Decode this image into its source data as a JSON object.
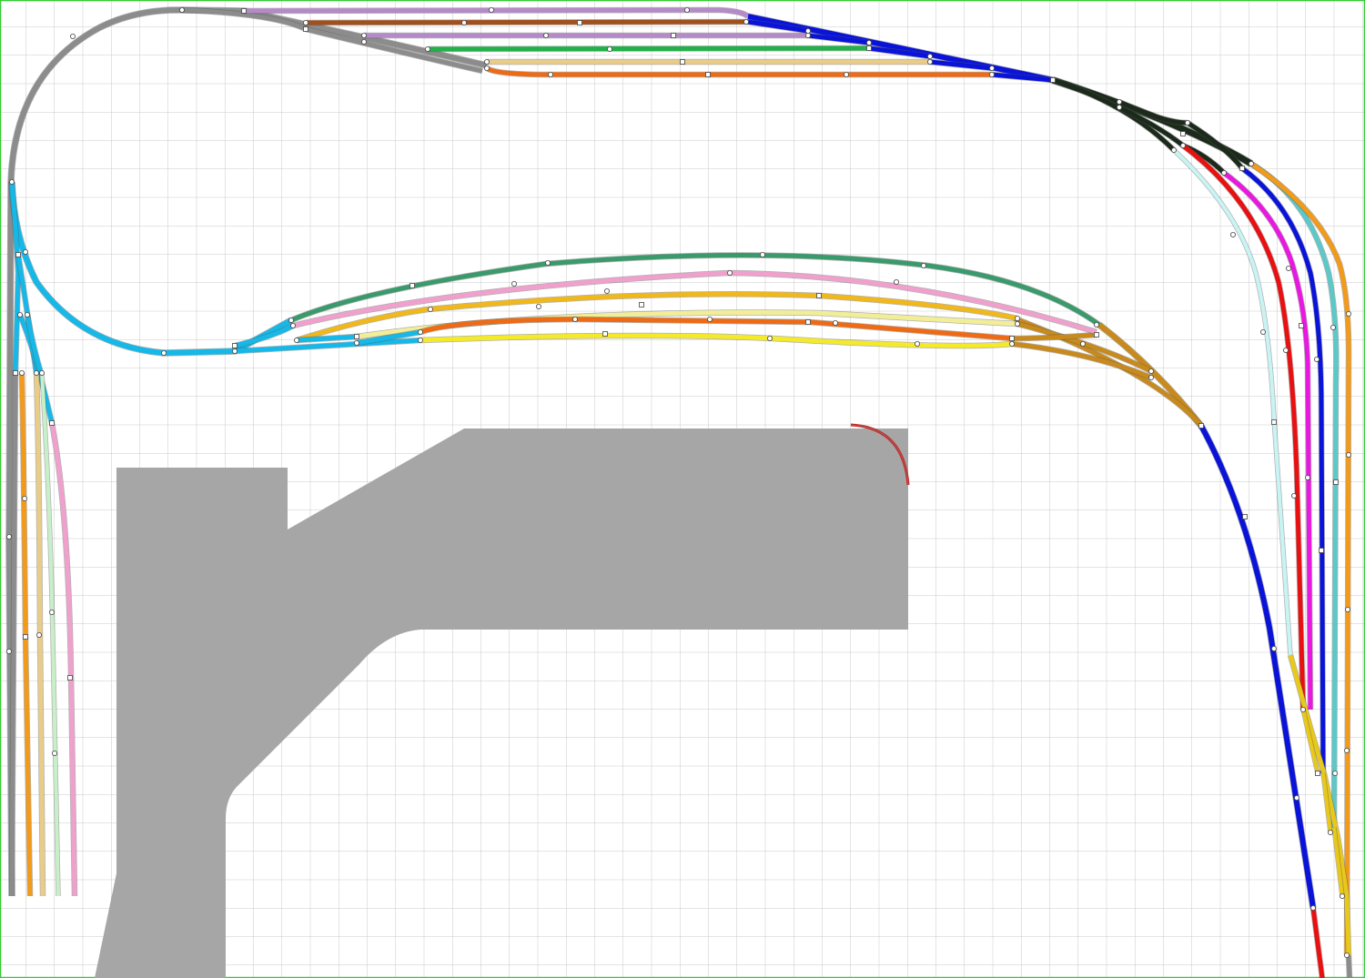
{
  "colors": {
    "background": "#ffffff",
    "grid_line": "#c8c8c8",
    "border": "#33cc33",
    "baseboard": "#a6a6a6",
    "mainline_blue": "#0a14d8",
    "loop_grey": "#8c8c8c",
    "junction_dark": "#1b2a1b",
    "cyan_fan": "#16b8e8",
    "ochre_fan": "#c88a1c",
    "yellow_fan": "#e8c81a"
  },
  "layout_elements": {
    "baseboard": "baseboard",
    "turntable_arc": "red-arc"
  },
  "tracks": {
    "loop": {
      "color": "#8c8c8c",
      "name": "return-loop"
    },
    "mainline": {
      "color": "#0a14d8",
      "name": "mainline"
    },
    "upper_sidings": [
      {
        "name": "siding-purple-1",
        "color": "#b48ac8"
      },
      {
        "name": "siding-brown",
        "color": "#a0501c"
      },
      {
        "name": "siding-purple-2",
        "color": "#b48ac8"
      },
      {
        "name": "siding-green",
        "color": "#22b04a"
      },
      {
        "name": "siding-tan",
        "color": "#e8cc88"
      },
      {
        "name": "siding-orange",
        "color": "#ee6a14"
      }
    ],
    "middle_yard": [
      {
        "name": "yard-sea-green",
        "color": "#3a9a6c"
      },
      {
        "name": "yard-pink",
        "color": "#f0a0cc"
      },
      {
        "name": "yard-gold",
        "color": "#f0b81a"
      },
      {
        "name": "yard-pale-yellow",
        "color": "#f2ee98"
      },
      {
        "name": "yard-orange",
        "color": "#ee6a14"
      },
      {
        "name": "yard-yellow",
        "color": "#f4ea2a"
      }
    ],
    "left_stubs": [
      {
        "name": "stub-grey",
        "color": "#8c8c8c"
      },
      {
        "name": "stub-orange",
        "color": "#f29a1a"
      },
      {
        "name": "stub-tan",
        "color": "#e8cc88"
      },
      {
        "name": "stub-pale-green",
        "color": "#c8f0c8"
      },
      {
        "name": "stub-pink",
        "color": "#f0a0cc"
      }
    ],
    "right_fan": [
      {
        "name": "fan-pale-cyan",
        "color": "#c8f4f4"
      },
      {
        "name": "fan-red",
        "color": "#e81010"
      },
      {
        "name": "fan-magenta",
        "color": "#e818e0"
      },
      {
        "name": "fan-blue",
        "color": "#0a14d8"
      },
      {
        "name": "fan-teal",
        "color": "#5cc8c8"
      },
      {
        "name": "fan-orange",
        "color": "#f29a1a"
      }
    ]
  }
}
